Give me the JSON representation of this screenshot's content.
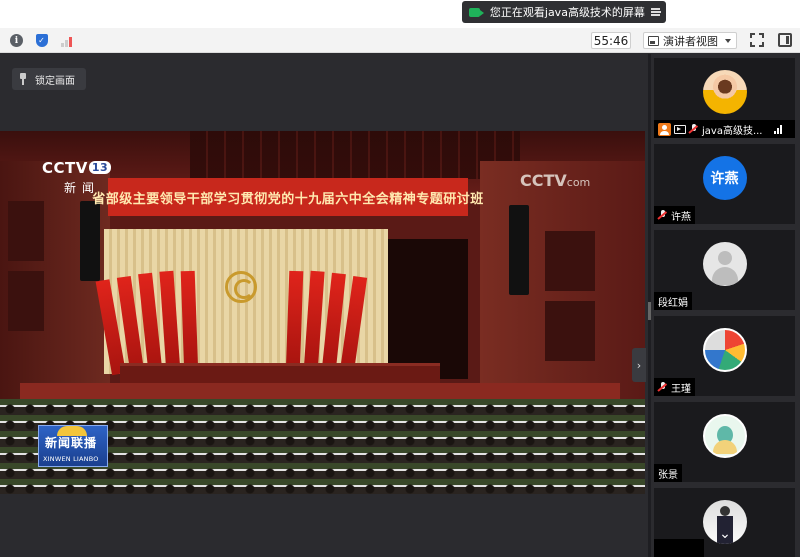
{
  "share_banner": {
    "text": "您正在观看java高级技术的屏幕"
  },
  "toolbar": {
    "timer": "55:46",
    "view_mode": "演讲者视图"
  },
  "main": {
    "lock_label": "锁定画面"
  },
  "video": {
    "channel_logo": "CCTV",
    "channel_number": "13",
    "channel_sub": "新闻",
    "banner_text": "省部级主要领导干部学习贯彻党的十九届六中全会精神专题研讨班",
    "watermark": "CCTV",
    "watermark_suffix": "com",
    "program_logo": "新闻联播",
    "program_logo_pinyin": "XINWEN LIANBO"
  },
  "participants": [
    {
      "name": "java高级技...",
      "avatar": "photo",
      "is_host": true,
      "sharing": true,
      "mic_muted": true
    },
    {
      "name": "许燕",
      "avatar_text": "许燕",
      "mic_muted": true
    },
    {
      "name": "段红娟",
      "avatar": "default"
    },
    {
      "name": "王瑾",
      "avatar": "photo",
      "mic_muted": true
    },
    {
      "name": "张景",
      "avatar": "photo"
    },
    {
      "name": "",
      "avatar": "photo"
    }
  ],
  "colors": {
    "accent_blue": "#1473e6",
    "share_green": "#1fb35a",
    "host_orange": "#f07a1a"
  }
}
